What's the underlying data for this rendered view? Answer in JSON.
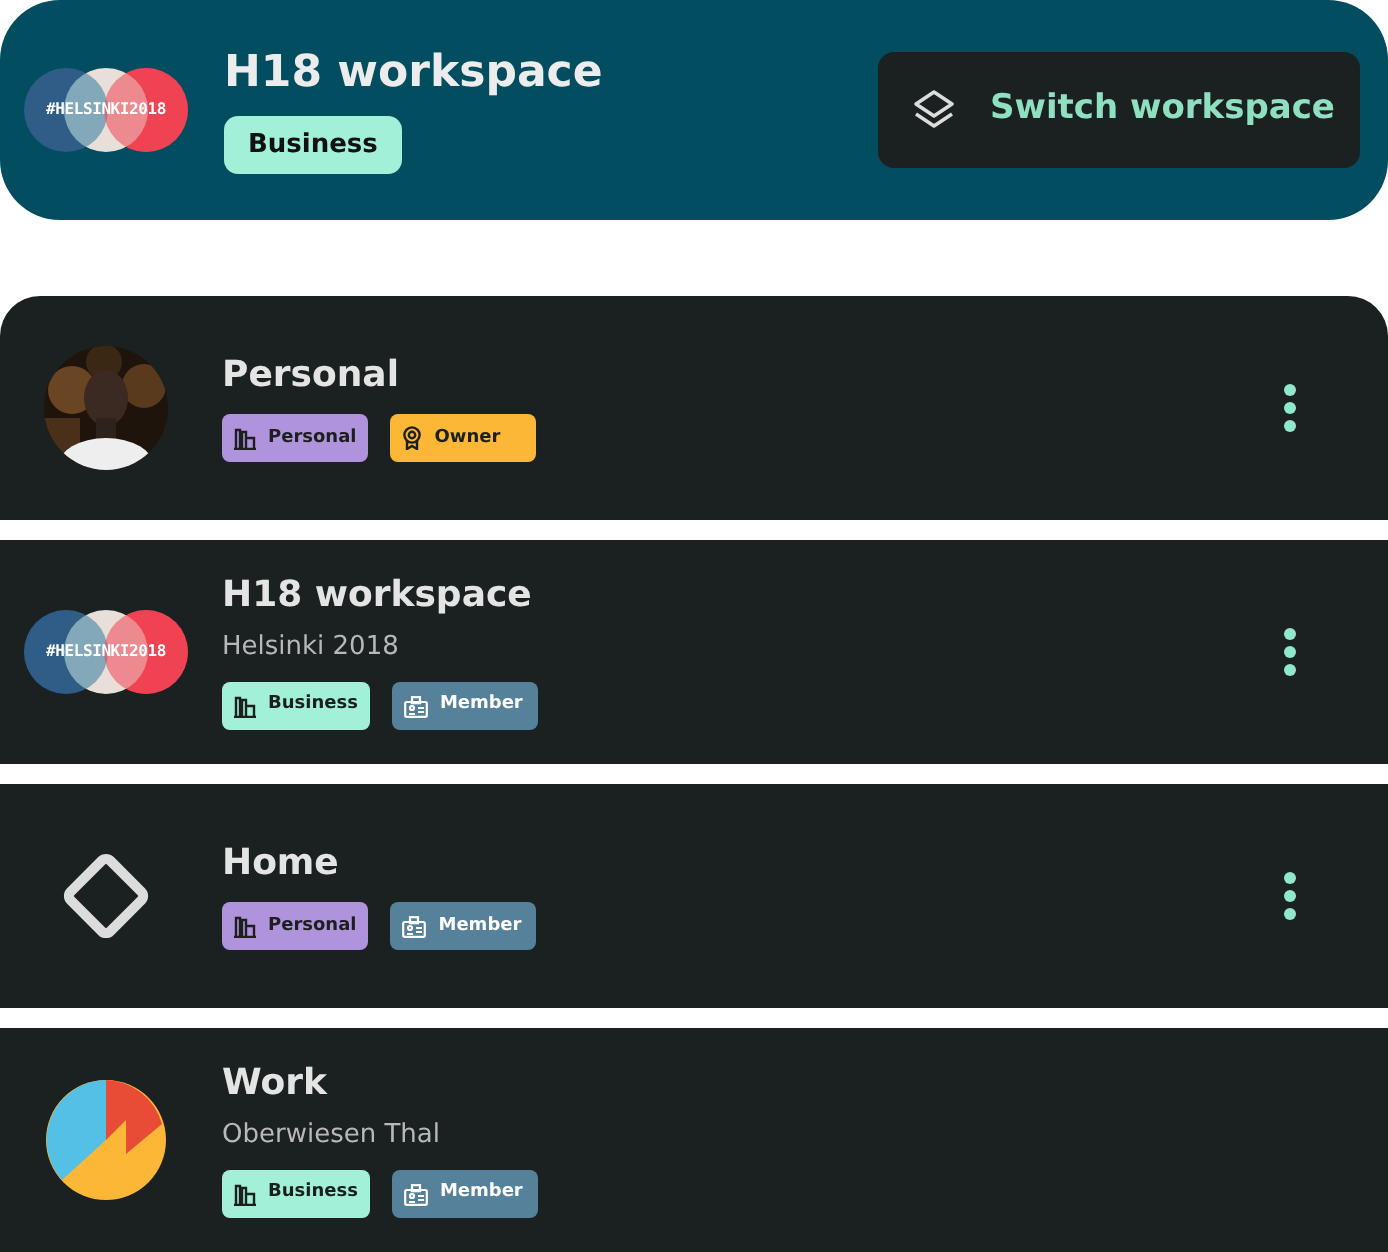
{
  "header": {
    "avatar": {
      "kind": "logo",
      "text": "#HELSINKI2018"
    },
    "title": "H18 workspace",
    "badge": {
      "label": "Business",
      "color": "#a3f0d8"
    },
    "button": "Switch workspace"
  },
  "workspaces": [
    {
      "name": "Personal",
      "badges": [
        {
          "label": "Personal",
          "kind": "plan",
          "color": "#b093dd"
        },
        {
          "label": "Owner",
          "kind": "owner",
          "color": "#fbb735"
        }
      ],
      "menu": true
    },
    {
      "name": "H18 workspace",
      "subtitle": "Helsinki 2018",
      "avatar": {
        "kind": "logo",
        "text": "#HELSINKI2018"
      },
      "badges": [
        {
          "label": "Business",
          "kind": "plan",
          "color": "#a3f0d8"
        },
        {
          "label": "Member",
          "kind": "member",
          "color": "#55819a"
        }
      ],
      "menu": true
    },
    {
      "name": "Home",
      "avatar": {
        "kind": "diamond"
      },
      "badges": [
        {
          "label": "Personal",
          "kind": "plan",
          "color": "#b093dd"
        },
        {
          "label": "Member",
          "kind": "member",
          "color": "#55819a"
        }
      ],
      "menu": true
    },
    {
      "name": "Work",
      "subtitle": "Oberwiesen Thal",
      "avatar": {
        "kind": "pie"
      },
      "badges": [
        {
          "label": "Business",
          "kind": "plan",
          "color": "#a3f0d8"
        },
        {
          "label": "Member",
          "kind": "member",
          "color": "#55819a"
        }
      ],
      "menu": false
    }
  ]
}
